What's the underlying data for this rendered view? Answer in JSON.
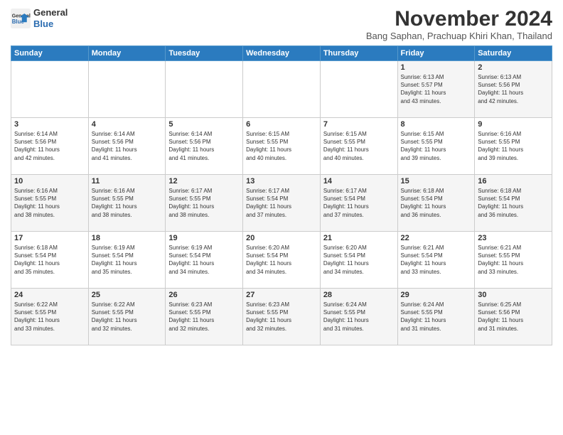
{
  "logo": {
    "line1": "General",
    "line2": "Blue"
  },
  "title": "November 2024",
  "subtitle": "Bang Saphan, Prachuap Khiri Khan, Thailand",
  "weekdays": [
    "Sunday",
    "Monday",
    "Tuesday",
    "Wednesday",
    "Thursday",
    "Friday",
    "Saturday"
  ],
  "weeks": [
    [
      {
        "day": "",
        "info": ""
      },
      {
        "day": "",
        "info": ""
      },
      {
        "day": "",
        "info": ""
      },
      {
        "day": "",
        "info": ""
      },
      {
        "day": "",
        "info": ""
      },
      {
        "day": "1",
        "info": "Sunrise: 6:13 AM\nSunset: 5:57 PM\nDaylight: 11 hours\nand 43 minutes."
      },
      {
        "day": "2",
        "info": "Sunrise: 6:13 AM\nSunset: 5:56 PM\nDaylight: 11 hours\nand 42 minutes."
      }
    ],
    [
      {
        "day": "3",
        "info": "Sunrise: 6:14 AM\nSunset: 5:56 PM\nDaylight: 11 hours\nand 42 minutes."
      },
      {
        "day": "4",
        "info": "Sunrise: 6:14 AM\nSunset: 5:56 PM\nDaylight: 11 hours\nand 41 minutes."
      },
      {
        "day": "5",
        "info": "Sunrise: 6:14 AM\nSunset: 5:56 PM\nDaylight: 11 hours\nand 41 minutes."
      },
      {
        "day": "6",
        "info": "Sunrise: 6:15 AM\nSunset: 5:55 PM\nDaylight: 11 hours\nand 40 minutes."
      },
      {
        "day": "7",
        "info": "Sunrise: 6:15 AM\nSunset: 5:55 PM\nDaylight: 11 hours\nand 40 minutes."
      },
      {
        "day": "8",
        "info": "Sunrise: 6:15 AM\nSunset: 5:55 PM\nDaylight: 11 hours\nand 39 minutes."
      },
      {
        "day": "9",
        "info": "Sunrise: 6:16 AM\nSunset: 5:55 PM\nDaylight: 11 hours\nand 39 minutes."
      }
    ],
    [
      {
        "day": "10",
        "info": "Sunrise: 6:16 AM\nSunset: 5:55 PM\nDaylight: 11 hours\nand 38 minutes."
      },
      {
        "day": "11",
        "info": "Sunrise: 6:16 AM\nSunset: 5:55 PM\nDaylight: 11 hours\nand 38 minutes."
      },
      {
        "day": "12",
        "info": "Sunrise: 6:17 AM\nSunset: 5:55 PM\nDaylight: 11 hours\nand 38 minutes."
      },
      {
        "day": "13",
        "info": "Sunrise: 6:17 AM\nSunset: 5:54 PM\nDaylight: 11 hours\nand 37 minutes."
      },
      {
        "day": "14",
        "info": "Sunrise: 6:17 AM\nSunset: 5:54 PM\nDaylight: 11 hours\nand 37 minutes."
      },
      {
        "day": "15",
        "info": "Sunrise: 6:18 AM\nSunset: 5:54 PM\nDaylight: 11 hours\nand 36 minutes."
      },
      {
        "day": "16",
        "info": "Sunrise: 6:18 AM\nSunset: 5:54 PM\nDaylight: 11 hours\nand 36 minutes."
      }
    ],
    [
      {
        "day": "17",
        "info": "Sunrise: 6:18 AM\nSunset: 5:54 PM\nDaylight: 11 hours\nand 35 minutes."
      },
      {
        "day": "18",
        "info": "Sunrise: 6:19 AM\nSunset: 5:54 PM\nDaylight: 11 hours\nand 35 minutes."
      },
      {
        "day": "19",
        "info": "Sunrise: 6:19 AM\nSunset: 5:54 PM\nDaylight: 11 hours\nand 34 minutes."
      },
      {
        "day": "20",
        "info": "Sunrise: 6:20 AM\nSunset: 5:54 PM\nDaylight: 11 hours\nand 34 minutes."
      },
      {
        "day": "21",
        "info": "Sunrise: 6:20 AM\nSunset: 5:54 PM\nDaylight: 11 hours\nand 34 minutes."
      },
      {
        "day": "22",
        "info": "Sunrise: 6:21 AM\nSunset: 5:54 PM\nDaylight: 11 hours\nand 33 minutes."
      },
      {
        "day": "23",
        "info": "Sunrise: 6:21 AM\nSunset: 5:55 PM\nDaylight: 11 hours\nand 33 minutes."
      }
    ],
    [
      {
        "day": "24",
        "info": "Sunrise: 6:22 AM\nSunset: 5:55 PM\nDaylight: 11 hours\nand 33 minutes."
      },
      {
        "day": "25",
        "info": "Sunrise: 6:22 AM\nSunset: 5:55 PM\nDaylight: 11 hours\nand 32 minutes."
      },
      {
        "day": "26",
        "info": "Sunrise: 6:23 AM\nSunset: 5:55 PM\nDaylight: 11 hours\nand 32 minutes."
      },
      {
        "day": "27",
        "info": "Sunrise: 6:23 AM\nSunset: 5:55 PM\nDaylight: 11 hours\nand 32 minutes."
      },
      {
        "day": "28",
        "info": "Sunrise: 6:24 AM\nSunset: 5:55 PM\nDaylight: 11 hours\nand 31 minutes."
      },
      {
        "day": "29",
        "info": "Sunrise: 6:24 AM\nSunset: 5:55 PM\nDaylight: 11 hours\nand 31 minutes."
      },
      {
        "day": "30",
        "info": "Sunrise: 6:25 AM\nSunset: 5:56 PM\nDaylight: 11 hours\nand 31 minutes."
      }
    ]
  ]
}
